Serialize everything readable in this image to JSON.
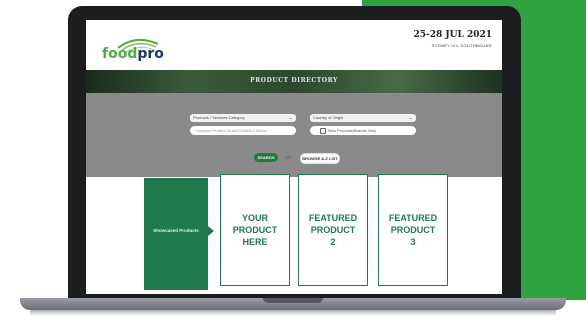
{
  "brand": {
    "logo_part1": "food",
    "logo_part2": "pro"
  },
  "event": {
    "dates": "25-28 JUL 2021",
    "venue": "SYDNEY ICC SOUTHBOUND"
  },
  "banner": {
    "title": "PRODUCT DIRECTORY"
  },
  "search": {
    "category_select": "Products / Services Category",
    "country_select": "Country of Origin",
    "keyword_placeholder": "Keyword Product Brand Exhibitor Name",
    "new_products_label": "New Products/Brands Only",
    "search_button": "SEARCH",
    "or_text": "OR",
    "reset_button": "BROWSE A-Z LIST"
  },
  "featured": {
    "directory_label": "Showcased Products",
    "cards": [
      {
        "lines": [
          "YOUR",
          "PRODUCT",
          "HERE"
        ]
      },
      {
        "lines": [
          "FEATURED",
          "PRODUCT",
          "2"
        ]
      },
      {
        "lines": [
          "FEATURED",
          "PRODUCT",
          "3"
        ]
      }
    ]
  },
  "colors": {
    "brand_green": "#2ea33f",
    "dark_green": "#1f7a4c",
    "navy": "#173a6b"
  }
}
